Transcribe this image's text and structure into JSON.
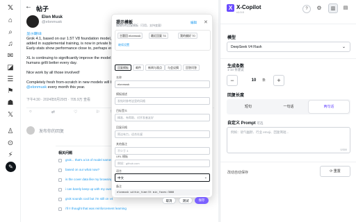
{
  "rail": {
    "icons": [
      "x-logo-icon",
      "home-icon",
      "explore-icon",
      "notifications-icon",
      "messages-icon",
      "grok-icon",
      "lists-icon",
      "bookmarks-icon",
      "communities-icon",
      "premium-icon",
      "profile-icon",
      "more-icon",
      "post-icon"
    ]
  },
  "feed": {
    "title": "帖子",
    "author": "Elon Musk",
    "handle": "@elonmusk",
    "translate_label": "显示翻译",
    "lines": [
      "Grok 4.1, based on our 1.5T V8 foundation model, w",
      "added in supplemental training, is now in private beta",
      "Early-stats show performance close to, perhaps even",
      "",
      "XL is continuing to significantly improve the model, pu",
      "humans grilli better every day.",
      "",
      "Nice work by all those involved!",
      "",
      "Completely fresh from-scratch in new models will be re",
      "every month this year."
    ],
    "at_link": "@elonmusk",
    "meta": "下午4:30 · 2024年8月29日 · 705.9万 查看",
    "actions": [
      "reply",
      "retweet",
      "like",
      "bookmark",
      "share"
    ],
    "reply_placeholder": "发布你的回复"
  },
  "suggestions": {
    "title": "相关问题",
    "items": [
      "grok... that's a lot of model names",
      "based on our what now?",
      "is the cover data like my browsing history?",
      "i can barely keep up with my own code",
      "grok sounds cool but i'm still on v4",
      "i'll !! thought that was reinforcement learning"
    ]
  },
  "modal": {
    "title": "提示模板",
    "subtitle": "编辑你的回复模板（可用，支持变量）",
    "edit_link": "编辑",
    "chips": [
      "主题回 elonmusk",
      "最近回复 74",
      "我的偏好 70"
    ],
    "chips_link": "继续设置",
    "tabs": [
      "回复模板",
      "邮件",
      "新闻与观点",
      "与会议摘",
      "回答问答"
    ],
    "fields": [
      {
        "label": "名称",
        "value": "elonmusk",
        "placeholder": false
      },
      {
        "label": "模板描述",
        "value": "发帖时参考这里的风格",
        "placeholder": true
      },
      {
        "label": "目标受众",
        "value": "精准、有帮助、对开发者友好",
        "placeholder": true
      },
      {
        "label": "回复风格",
        "value": "简洁有力，适合社媒",
        "placeholder": true
      },
      {
        "label": "其他备注",
        "value": "不少于 3",
        "placeholder": true
      },
      {
        "label": "URL 模板",
        "value": "例如：github.com",
        "placeholder": true
      }
    ],
    "select_label": "语言",
    "select_value": "中文",
    "code_label": "备注",
    "code_value": "elonmusk within_time:5t min_faves:3000",
    "buttons": {
      "cancel": "取消",
      "test": "测试",
      "save": "保存"
    }
  },
  "panel": {
    "logo": "X",
    "title": "X-Copilot",
    "version": "v1.0.0",
    "header_icons": [
      "help-icon",
      "settings-icon",
      "sidebar-left-icon",
      "sidebar-right-icon"
    ],
    "model_section": "模型",
    "model_value": "DeepSeek V4 Flash",
    "gen_section": "生成条数",
    "gen_range": "1-10 条建议",
    "gen_value": "10",
    "gen_unit": "条",
    "length_section": "回复长度",
    "length_options": [
      "短句",
      "一句话",
      "两句话"
    ],
    "length_selected": 2,
    "prompt_section": "自定义 Prompt",
    "prompt_optional": "可选",
    "prompt_placeholder": "例如：语气幽默、行业 emoji、回复简短...",
    "prompt_counter": "0/300",
    "autosave": "改动自动保存",
    "reset": "重置",
    "accent": "#6a4cff"
  }
}
